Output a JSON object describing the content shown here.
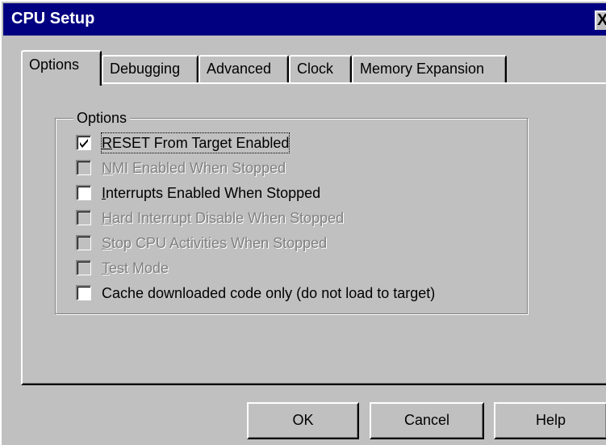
{
  "window": {
    "title": "CPU Setup",
    "close_glyph": "X"
  },
  "tabs": [
    {
      "label": "Options",
      "active": true
    },
    {
      "label": "Debugging",
      "active": false
    },
    {
      "label": "Advanced",
      "active": false
    },
    {
      "label": "Clock",
      "active": false
    },
    {
      "label": "Memory Expansion",
      "active": false
    }
  ],
  "group": {
    "title": "Options"
  },
  "options": [
    {
      "label_first": "R",
      "label_rest": "ESET From Target Enabled",
      "checked": true,
      "enabled": true
    },
    {
      "label_first": "N",
      "label_rest": "MI Enabled When Stopped",
      "checked": false,
      "enabled": false
    },
    {
      "label_first": "I",
      "label_rest": "nterrupts Enabled When Stopped",
      "checked": false,
      "enabled": true
    },
    {
      "label_first": "H",
      "label_rest": "ard Interrupt Disable When Stopped",
      "checked": false,
      "enabled": false
    },
    {
      "label_first": "S",
      "label_rest": "top CPU Activities When Stopped",
      "checked": false,
      "enabled": false
    },
    {
      "label_first": "T",
      "label_rest": "est Mode",
      "checked": false,
      "enabled": false
    },
    {
      "label_first": "",
      "label_rest": "Cache downloaded code only (do not load to target)",
      "checked": false,
      "enabled": true
    }
  ],
  "buttons": {
    "ok": "OK",
    "cancel": "Cancel",
    "help": "Help"
  },
  "colors": {
    "titlebar": "#000080",
    "face": "#c0c0c0",
    "disabled_text": "#808080"
  },
  "icons": {
    "close": "close-icon",
    "check": "checkmark-icon"
  }
}
